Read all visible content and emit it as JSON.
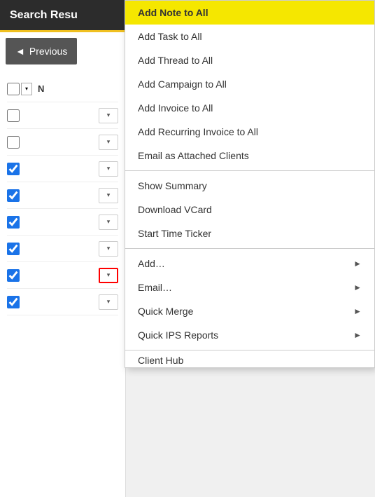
{
  "header": {
    "title": "Search Resu",
    "accent_color": "#f0c020"
  },
  "prev_button": {
    "label": "Previous",
    "icon": "◄"
  },
  "checkboxes": [
    {
      "id": "cb0",
      "checked": false,
      "has_master_dropdown": true,
      "col_label": "N",
      "row_dropdown": true,
      "row_dropdown_red": false
    },
    {
      "id": "cb1",
      "checked": false,
      "has_master_dropdown": false,
      "row_dropdown": true,
      "row_dropdown_red": false
    },
    {
      "id": "cb2",
      "checked": false,
      "has_master_dropdown": false,
      "row_dropdown": true,
      "row_dropdown_red": false
    },
    {
      "id": "cb3",
      "checked": true,
      "has_master_dropdown": false,
      "row_dropdown": true,
      "row_dropdown_red": false
    },
    {
      "id": "cb4",
      "checked": true,
      "has_master_dropdown": false,
      "row_dropdown": true,
      "row_dropdown_red": false
    },
    {
      "id": "cb5",
      "checked": true,
      "has_master_dropdown": false,
      "row_dropdown": true,
      "row_dropdown_red": false
    },
    {
      "id": "cb6",
      "checked": true,
      "has_master_dropdown": false,
      "row_dropdown": true,
      "row_dropdown_red": false
    },
    {
      "id": "cb7",
      "checked": true,
      "has_master_dropdown": false,
      "row_dropdown": true,
      "row_dropdown_red": true
    },
    {
      "id": "cb8",
      "checked": true,
      "has_master_dropdown": false,
      "row_dropdown": true,
      "row_dropdown_red": false
    }
  ],
  "menu": {
    "items": [
      {
        "id": "add-note-all",
        "label": "Add Note to All",
        "highlighted": true,
        "has_submenu": false
      },
      {
        "id": "add-task-all",
        "label": "Add Task to All",
        "highlighted": false,
        "has_submenu": false
      },
      {
        "id": "add-thread-all",
        "label": "Add Thread to All",
        "highlighted": false,
        "has_submenu": false
      },
      {
        "id": "add-campaign-all",
        "label": "Add Campaign to All",
        "highlighted": false,
        "has_submenu": false
      },
      {
        "id": "add-invoice-all",
        "label": "Add Invoice to All",
        "highlighted": false,
        "has_submenu": false
      },
      {
        "id": "add-recurring-invoice-all",
        "label": "Add Recurring Invoice to All",
        "highlighted": false,
        "has_submenu": false
      },
      {
        "id": "email-attached-clients",
        "label": "Email as Attached Clients",
        "highlighted": false,
        "has_submenu": false
      },
      {
        "divider": true
      },
      {
        "id": "show-summary",
        "label": "Show Summary",
        "highlighted": false,
        "has_submenu": false
      },
      {
        "id": "download-vcard",
        "label": "Download VCard",
        "highlighted": false,
        "has_submenu": false
      },
      {
        "id": "start-time-ticker",
        "label": "Start Time Ticker",
        "highlighted": false,
        "has_submenu": false
      },
      {
        "divider": true
      },
      {
        "id": "add-submenu",
        "label": "Add…",
        "highlighted": false,
        "has_submenu": true
      },
      {
        "id": "email-submenu",
        "label": "Email…",
        "highlighted": false,
        "has_submenu": true
      },
      {
        "id": "quick-merge",
        "label": "Quick Merge",
        "highlighted": false,
        "has_submenu": true
      },
      {
        "id": "quick-ips-reports",
        "label": "Quick IPS Reports",
        "highlighted": false,
        "has_submenu": true
      },
      {
        "divider": true
      },
      {
        "id": "client-hub",
        "label": "Client Hub",
        "highlighted": false,
        "has_submenu": false,
        "partial": true
      }
    ],
    "chevron": "►"
  }
}
